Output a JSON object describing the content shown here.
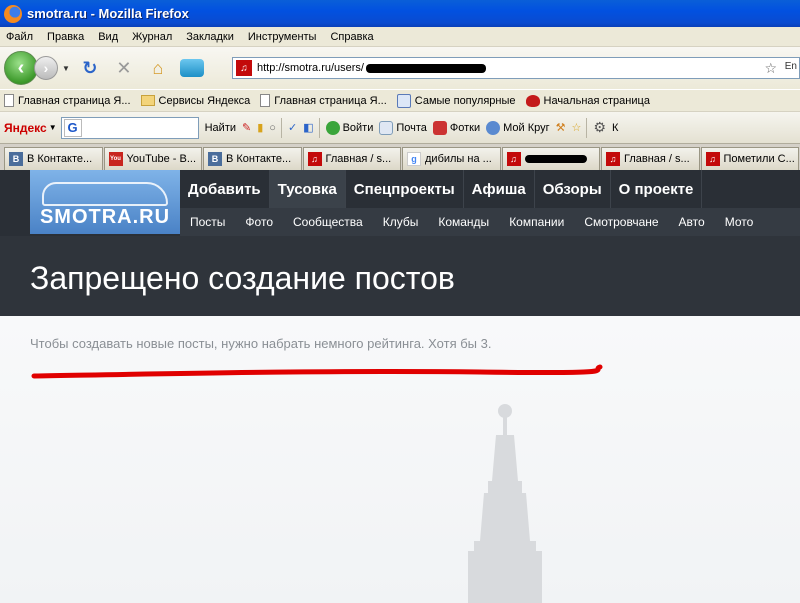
{
  "window": {
    "title": "smotra.ru - Mozilla Firefox"
  },
  "menu": [
    "Файл",
    "Правка",
    "Вид",
    "Журнал",
    "Закладки",
    "Инструменты",
    "Справка"
  ],
  "url": {
    "value": "http://smotra.ru/users/",
    "lang": "En"
  },
  "bookmarks": [
    {
      "label": "Главная страница Я...",
      "icon": "doc-icon"
    },
    {
      "label": "Сервисы Яндекса",
      "icon": "folder-icon"
    },
    {
      "label": "Главная страница Я...",
      "icon": "doc-icon"
    },
    {
      "label": "Самые популярные",
      "icon": "search-icon"
    },
    {
      "label": "Начальная страница",
      "icon": "bug-icon"
    }
  ],
  "yandex_bar": {
    "logo": "Яндекс",
    "find_label": "Найти",
    "login_label": "Войти",
    "mail_label": "Почта",
    "photos_label": "Фотки",
    "circle_label": "Мой Круг",
    "more_label": "К"
  },
  "tabs": [
    {
      "label": "В Контакте...",
      "fav": "В",
      "type": "vk"
    },
    {
      "label": "YouTube - B...",
      "fav": "You",
      "type": "yt"
    },
    {
      "label": "В Контакте...",
      "fav": "В",
      "type": "vk"
    },
    {
      "label": "Главная / s...",
      "fav": "",
      "type": "sm"
    },
    {
      "label": "дибилы на ...",
      "fav": "g",
      "type": "g"
    },
    {
      "label": "",
      "fav": "",
      "type": "redacted"
    },
    {
      "label": "Главная / s...",
      "fav": "",
      "type": "sm"
    },
    {
      "label": "Пометили С...",
      "fav": "",
      "type": "sm"
    }
  ],
  "site": {
    "logo": "SMOTRA.RU",
    "nav": [
      "Добавить",
      "Тусовка",
      "Спецпроекты",
      "Афиша",
      "Обзоры",
      "О проекте"
    ],
    "active_nav": "Тусовка",
    "subnav": [
      "Посты",
      "Фото",
      "Сообщества",
      "Клубы",
      "Команды",
      "Компании",
      "Смотровчане",
      "Авто",
      "Мото"
    ],
    "page_title": "Запрещено создание постов",
    "message": "Чтобы создавать новые посты, нужно набрать немного рейтинга. Хотя бы 3."
  },
  "colors": {
    "header": "#2a2f36",
    "logo_blue": "#5b8fd0",
    "red_mark": "#e00000"
  }
}
